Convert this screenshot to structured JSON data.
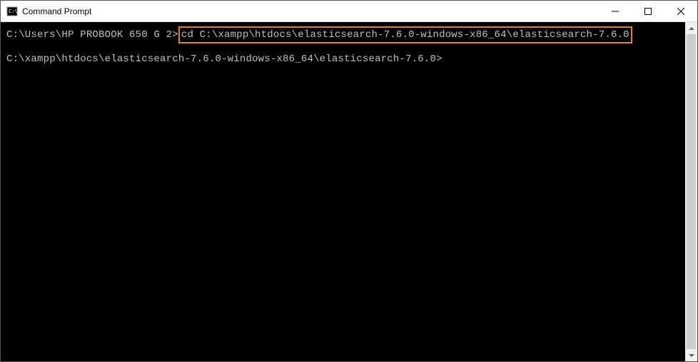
{
  "titlebar": {
    "title": "Command Prompt"
  },
  "terminal": {
    "line1": {
      "prompt": "C:\\Users\\HP PROBOOK 650 G 2>",
      "command": "cd C:\\xampp\\htdocs\\elasticsearch-7.6.0-windows-x86_64\\elasticsearch-7.6.0"
    },
    "line2": {
      "prompt": "C:\\xampp\\htdocs\\elasticsearch-7.6.0-windows-x86_64\\elasticsearch-7.6.0>"
    }
  }
}
